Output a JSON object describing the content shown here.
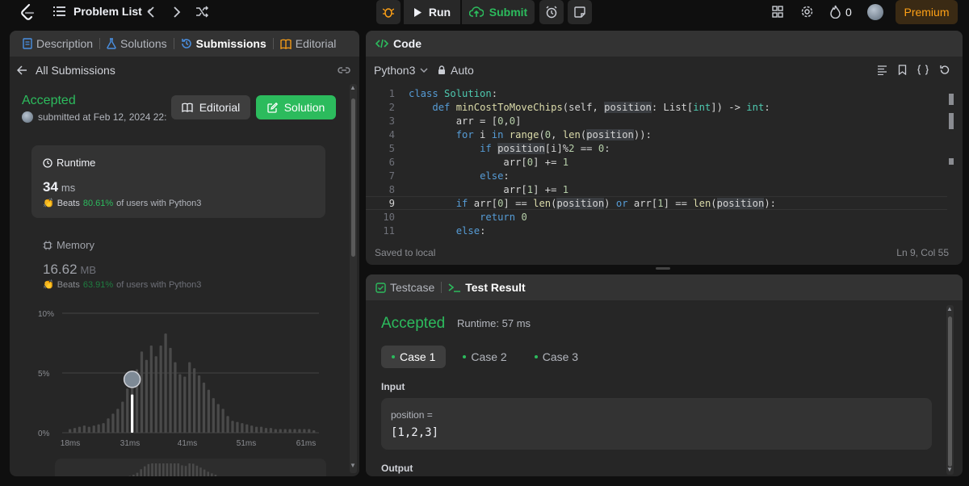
{
  "topbar": {
    "problem_list": "Problem List",
    "run": "Run",
    "submit": "Submit",
    "streak": "0",
    "premium": "Premium"
  },
  "left": {
    "tabs": [
      "Description",
      "Solutions",
      "Submissions",
      "Editorial"
    ],
    "back": "All Submissions",
    "status": "Accepted",
    "submitted": "submitted at Feb 12, 2024 22:",
    "editorial_btn": "Editorial",
    "solution_btn": "Solution",
    "runtime": {
      "title": "Runtime",
      "value": "34",
      "unit": "ms",
      "beats_label": "Beats",
      "beats_pct": "80.61%",
      "beats_suffix": "of users with Python3"
    },
    "memory": {
      "title": "Memory",
      "value": "16.62",
      "unit": "MB",
      "beats_label": "Beats",
      "beats_pct": "63.91%",
      "beats_suffix": "of users with Python3"
    }
  },
  "chart_data": {
    "type": "bar",
    "y_ticks": [
      "10%",
      "5%",
      "0%"
    ],
    "x_ticks": [
      "18ms",
      "31ms",
      "41ms",
      "51ms",
      "61ms"
    ],
    "ylim": [
      0,
      10
    ],
    "highlight_index": 13,
    "values": [
      0.3,
      0.4,
      0.5,
      0.6,
      0.5,
      0.6,
      0.7,
      0.8,
      1.2,
      1.6,
      2.0,
      2.6,
      3.7,
      4.6,
      5.3,
      6.8,
      6.1,
      7.3,
      6.4,
      7.3,
      8.3,
      7.1,
      5.9,
      4.9,
      4.7,
      5.9,
      5.4,
      4.8,
      4.2,
      3.6,
      2.9,
      2.4,
      2.0,
      1.4,
      1.0,
      0.9,
      0.8,
      0.7,
      0.6,
      0.5,
      0.5,
      0.4,
      0.4,
      0.3,
      0.3,
      0.3,
      0.3,
      0.3,
      0.3,
      0.3,
      0.3,
      0.2
    ],
    "highlight_value": 3.2
  },
  "code": {
    "title": "Code",
    "language": "Python3",
    "mode": "Auto",
    "saved": "Saved to local",
    "cursor": "Ln 9, Col 55",
    "line_numbers": [
      "1",
      "2",
      "3",
      "4",
      "5",
      "6",
      "7",
      "8",
      "9",
      "10",
      "11"
    ]
  },
  "test": {
    "tab_testcase": "Testcase",
    "tab_result": "Test Result",
    "status": "Accepted",
    "runtime": "Runtime: 57 ms",
    "cases": [
      "Case 1",
      "Case 2",
      "Case 3"
    ],
    "input_label": "Input",
    "var_name": "position =",
    "var_value": "[1,2,3]",
    "output_label": "Output"
  }
}
